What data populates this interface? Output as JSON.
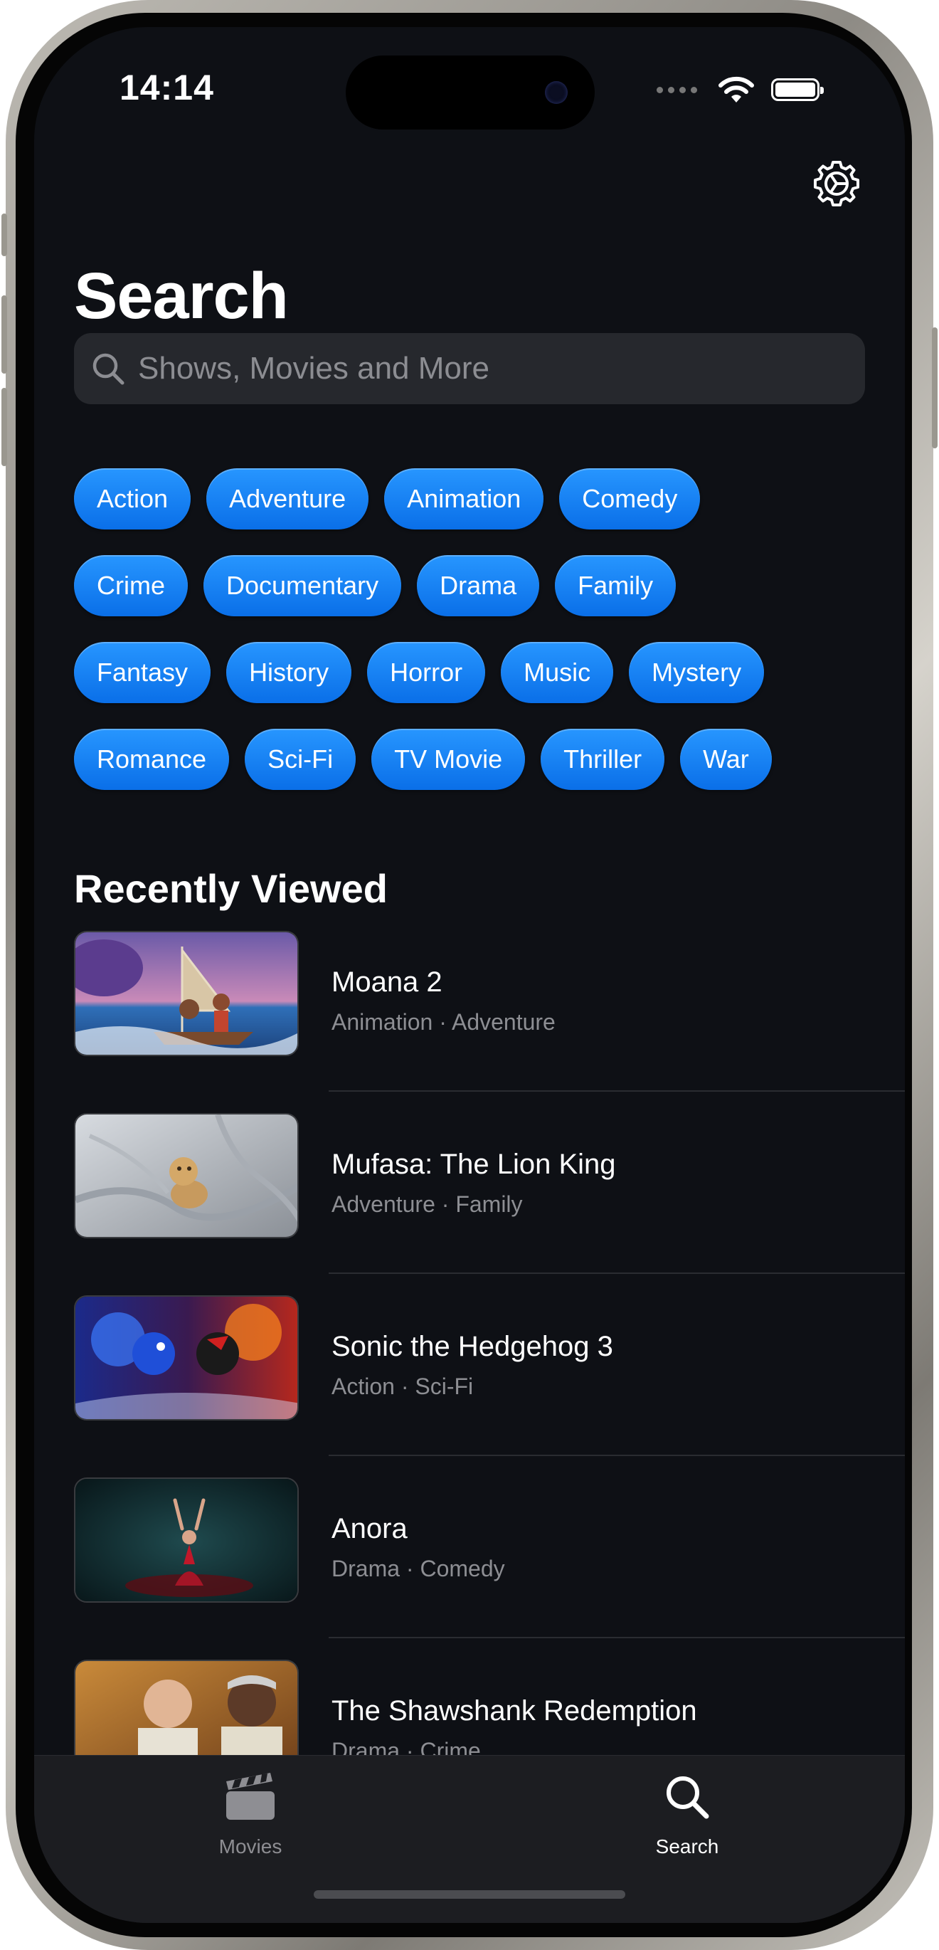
{
  "status_bar": {
    "time": "14:14"
  },
  "page": {
    "title": "Search"
  },
  "search": {
    "placeholder": "Shows, Movies and More"
  },
  "genres": [
    [
      "Action",
      "Adventure",
      "Animation",
      "Comedy"
    ],
    [
      "Crime",
      "Documentary",
      "Drama",
      "Family"
    ],
    [
      "Fantasy",
      "History",
      "Horror",
      "Music",
      "Mystery"
    ],
    [
      "Romance",
      "Sci-Fi",
      "TV Movie",
      "Thriller",
      "War"
    ]
  ],
  "recently_viewed": {
    "title": "Recently Viewed",
    "items": [
      {
        "title": "Moana 2",
        "genres": "Animation · Adventure"
      },
      {
        "title": "Mufasa: The Lion King",
        "genres": "Adventure · Family"
      },
      {
        "title": "Sonic the Hedgehog 3",
        "genres": "Action · Sci-Fi"
      },
      {
        "title": "Anora",
        "genres": "Drama · Comedy"
      },
      {
        "title": "The Shawshank Redemption",
        "genres": "Drama · Crime"
      }
    ]
  },
  "tab_bar": {
    "movies": {
      "label": "Movies",
      "icon": "clapperboard-icon",
      "active": false
    },
    "search": {
      "label": "Search",
      "icon": "magnifying-glass-icon",
      "active": true
    }
  },
  "colors": {
    "background": "#0e1015",
    "chip": "#1a84f5",
    "tab_active": "#ffffff",
    "tab_inactive": "#8e8e93"
  }
}
